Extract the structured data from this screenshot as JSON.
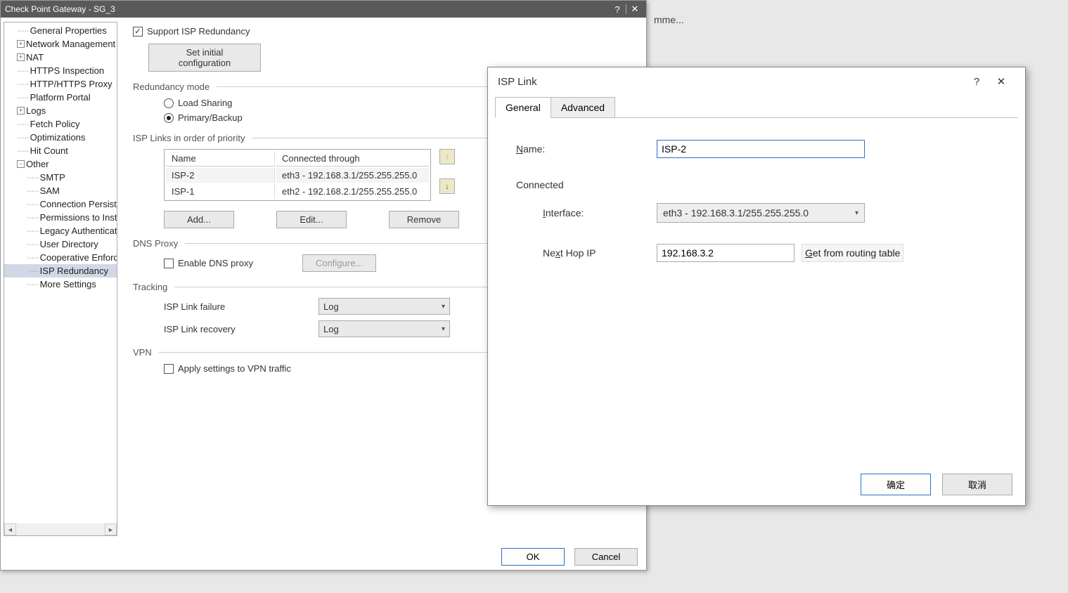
{
  "bg_hint": "mme...",
  "gateway": {
    "title": "Check Point Gateway - SG_3",
    "tree": {
      "items": [
        {
          "label": "General Properties",
          "exp": null,
          "indent": 0
        },
        {
          "label": "Network Management",
          "exp": "+",
          "indent": 0
        },
        {
          "label": "NAT",
          "exp": "+",
          "indent": 0
        },
        {
          "label": "HTTPS Inspection",
          "exp": null,
          "indent": 0
        },
        {
          "label": "HTTP/HTTPS Proxy",
          "exp": null,
          "indent": 0
        },
        {
          "label": "Platform Portal",
          "exp": null,
          "indent": 0
        },
        {
          "label": "Logs",
          "exp": "+",
          "indent": 0
        },
        {
          "label": "Fetch Policy",
          "exp": null,
          "indent": 0
        },
        {
          "label": "Optimizations",
          "exp": null,
          "indent": 0
        },
        {
          "label": "Hit Count",
          "exp": null,
          "indent": 0
        },
        {
          "label": "Other",
          "exp": "-",
          "indent": 0
        },
        {
          "label": "SMTP",
          "exp": null,
          "indent": 1
        },
        {
          "label": "SAM",
          "exp": null,
          "indent": 1
        },
        {
          "label": "Connection Persiste",
          "exp": null,
          "indent": 1
        },
        {
          "label": "Permissions to Insta",
          "exp": null,
          "indent": 1
        },
        {
          "label": "Legacy Authenticati",
          "exp": null,
          "indent": 1
        },
        {
          "label": "User Directory",
          "exp": null,
          "indent": 1
        },
        {
          "label": "Cooperative Enforc",
          "exp": null,
          "indent": 1
        },
        {
          "label": "ISP Redundancy",
          "exp": null,
          "indent": 1,
          "selected": true
        },
        {
          "label": "More Settings",
          "exp": null,
          "indent": 1
        }
      ]
    },
    "support_label": "Support ISP Redundancy",
    "set_initial_btn": "Set initial configuration",
    "redundancy_header": "Redundancy mode",
    "load_sharing": "Load Sharing",
    "primary_backup": "Primary/Backup",
    "isp_links_header": "ISP Links in order of priority",
    "table": {
      "col_name": "Name",
      "col_connected": "Connected through",
      "rows": [
        {
          "name": "ISP-2",
          "conn": "eth3 - 192.168.3.1/255.255.255.0",
          "sel": true
        },
        {
          "name": "ISP-1",
          "conn": "eth2 - 192.168.2.1/255.255.255.0",
          "sel": false
        }
      ]
    },
    "btn_add": "Add...",
    "btn_edit": "Edit...",
    "btn_remove": "Remove",
    "dns_header": "DNS Proxy",
    "enable_dns": "Enable DNS proxy",
    "configure_btn": "Configure...",
    "tracking_header": "Tracking",
    "link_failure_lbl": "ISP Link failure",
    "link_failure_val": "Log",
    "link_recovery_lbl": "ISP Link recovery",
    "link_recovery_val": "Log",
    "vpn_header": "VPN",
    "apply_vpn": "Apply settings to VPN traffic",
    "ok": "OK",
    "cancel": "Cancel"
  },
  "isp": {
    "title": "ISP Link",
    "tab_general": "General",
    "tab_advanced": "Advanced",
    "name_lbl_pre": "N",
    "name_lbl_post": "ame:",
    "name_val": "ISP-2",
    "connected_lbl": "Connected",
    "interface_lbl_pre": "I",
    "interface_lbl_post": "nterface:",
    "interface_val": "eth3 - 192.168.3.1/255.255.255.0",
    "nexthop_lbl_pre": "Ne",
    "nexthop_lbl_u": "x",
    "nexthop_lbl_post": "t Hop IP",
    "nexthop_val": "192.168.3.2",
    "get_routing_pre": "G",
    "get_routing_post": "et from routing table",
    "ok": "确定",
    "cancel": "取消"
  }
}
